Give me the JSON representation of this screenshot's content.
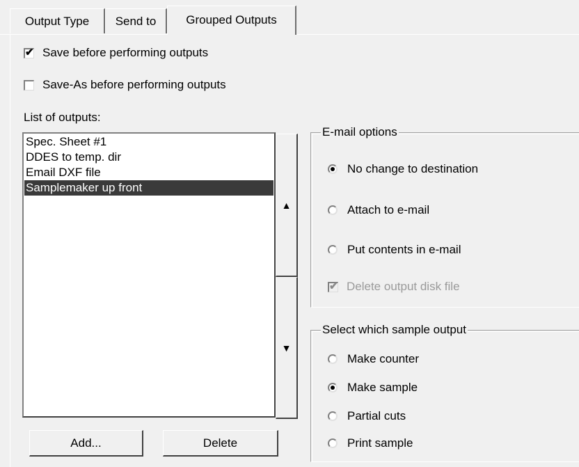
{
  "tabs": [
    {
      "label": "Output Type"
    },
    {
      "label": "Send to"
    },
    {
      "label": "Grouped Outputs"
    }
  ],
  "options": {
    "save_before": {
      "label": "Save before performing outputs",
      "checked": true
    },
    "save_as_before": {
      "label": "Save-As before performing outputs",
      "checked": false
    }
  },
  "outputs": {
    "label": "List of outputs:",
    "items": [
      "Spec. Sheet #1",
      "DDES to temp. dir",
      "Email DXF file",
      "Samplemaker up front"
    ],
    "selected": "Samplemaker up front",
    "add_label": "Add...",
    "delete_label": "Delete",
    "move_up_icon": "triangle-up-icon",
    "move_down_icon": "triangle-down-icon"
  },
  "email_options": {
    "legend": "E-mail options",
    "radios": [
      {
        "label": "No change to destination",
        "checked": true
      },
      {
        "label": "Attach to e-mail",
        "checked": false
      },
      {
        "label": "Put contents in e-mail",
        "checked": false
      }
    ],
    "delete_file": {
      "label": "Delete output disk file",
      "checked": true,
      "enabled": false
    }
  },
  "sample_output": {
    "legend": "Select which sample output",
    "radios": [
      {
        "label": "Make counter",
        "checked": false
      },
      {
        "label": "Make sample",
        "checked": true
      },
      {
        "label": "Partial cuts",
        "checked": false
      },
      {
        "label": "Print sample",
        "checked": false
      }
    ]
  }
}
